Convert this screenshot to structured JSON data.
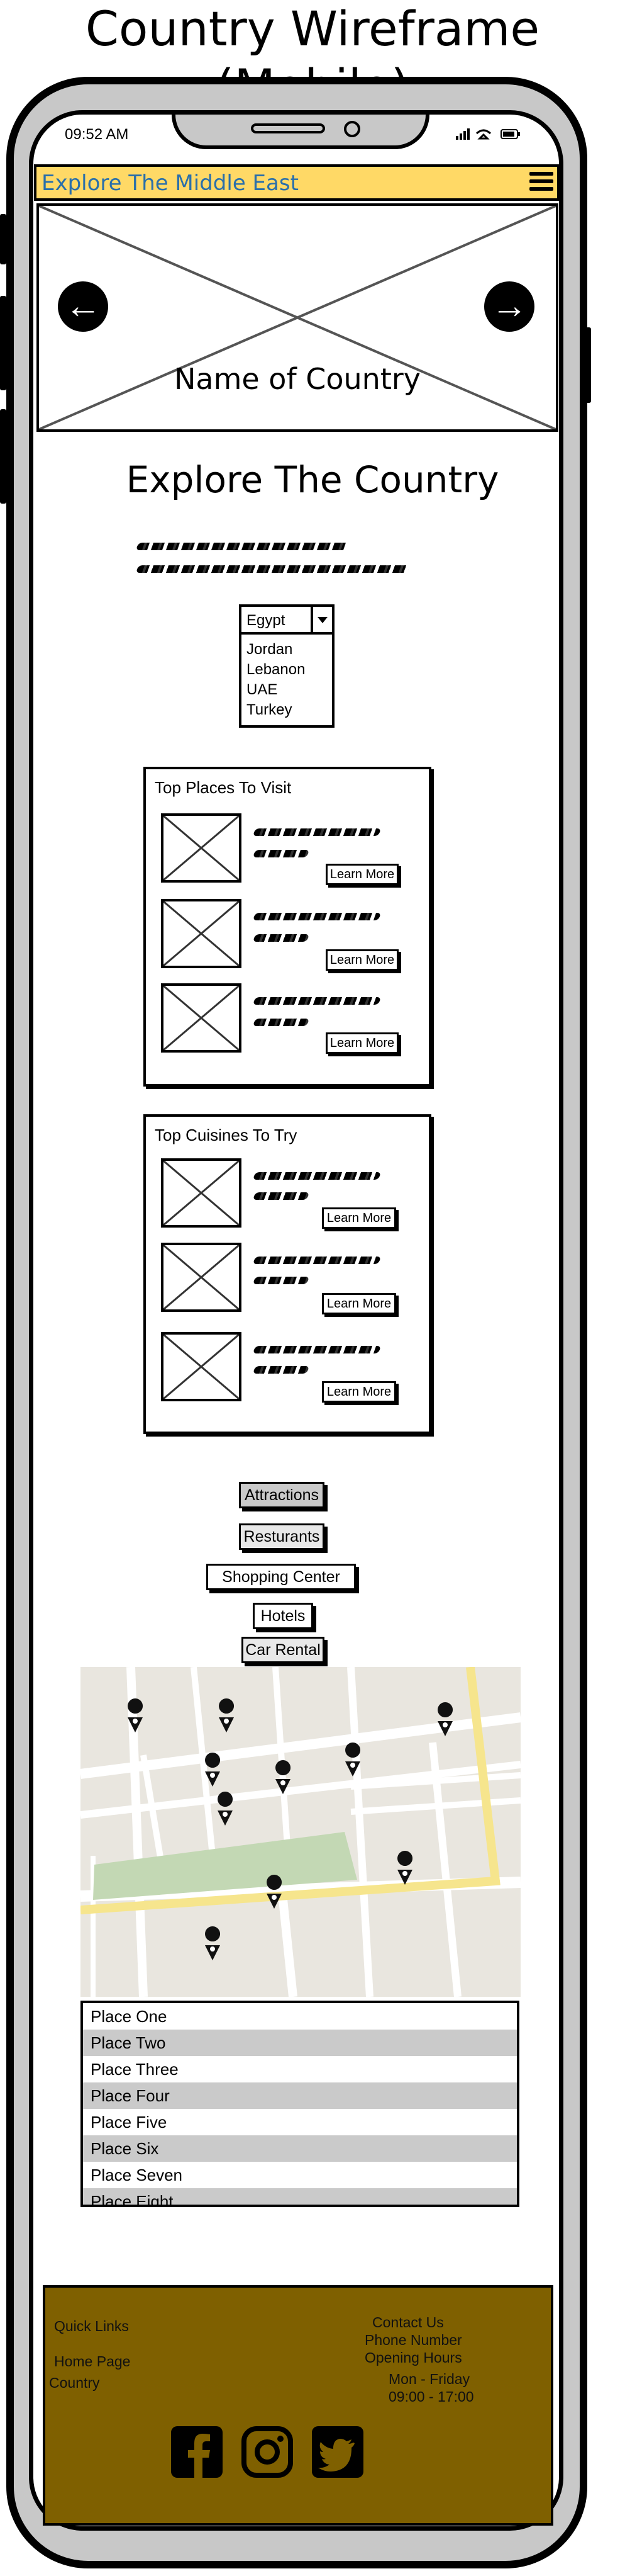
{
  "page": {
    "title": "Country Wireframe (Mobile)"
  },
  "status_bar": {
    "time": "09:52 AM"
  },
  "nav": {
    "title": "Explore The Middle East",
    "menu_icon": "hamburger-icon"
  },
  "hero": {
    "caption": "Name of Country",
    "prev_icon": "arrow-left-icon",
    "next_icon": "arrow-right-icon"
  },
  "main": {
    "heading": "Explore The Country"
  },
  "country_select": {
    "selected": "Egypt",
    "options": [
      "Jordan",
      "Lebanon",
      "UAE",
      "Turkey"
    ]
  },
  "places": {
    "title": "Top Places To Visit",
    "items": [
      {
        "button": "Learn More"
      },
      {
        "button": "Learn More"
      },
      {
        "button": "Learn More"
      }
    ]
  },
  "cuisines": {
    "title": "Top Cuisines To Try",
    "items": [
      {
        "button": "Learn More"
      },
      {
        "button": "Learn More"
      },
      {
        "button": "Learn More"
      }
    ]
  },
  "categories": [
    {
      "label": "Attractions",
      "selected": true
    },
    {
      "label": "Resturants",
      "selected": true
    },
    {
      "label": "Shopping Center",
      "selected": false
    },
    {
      "label": "Hotels",
      "selected": false
    },
    {
      "label": "Car Rental",
      "selected": true
    }
  ],
  "place_list": [
    "Place One",
    "Place Two",
    "Place Three",
    "Place Four",
    "Place Five",
    "Place Six",
    "Place Seven",
    "Place Eight"
  ],
  "footer": {
    "quick_links_title": "Quick Links",
    "links": [
      "Home Page",
      "Country"
    ],
    "contact": [
      "Contact Us",
      "Phone Number",
      "Opening Hours",
      "Mon - Friday",
      "09:00 - 17:00"
    ],
    "social_icons": [
      "facebook-icon",
      "instagram-icon",
      "twitter-icon"
    ]
  },
  "colors": {
    "nav_bg": "#ffd966",
    "nav_title": "#2a6faa",
    "footer_bg": "#7f6000",
    "phone_frame": "#c8c8c8",
    "road_yellow": "#f6e58d",
    "park_green": "#c3d8b4"
  }
}
